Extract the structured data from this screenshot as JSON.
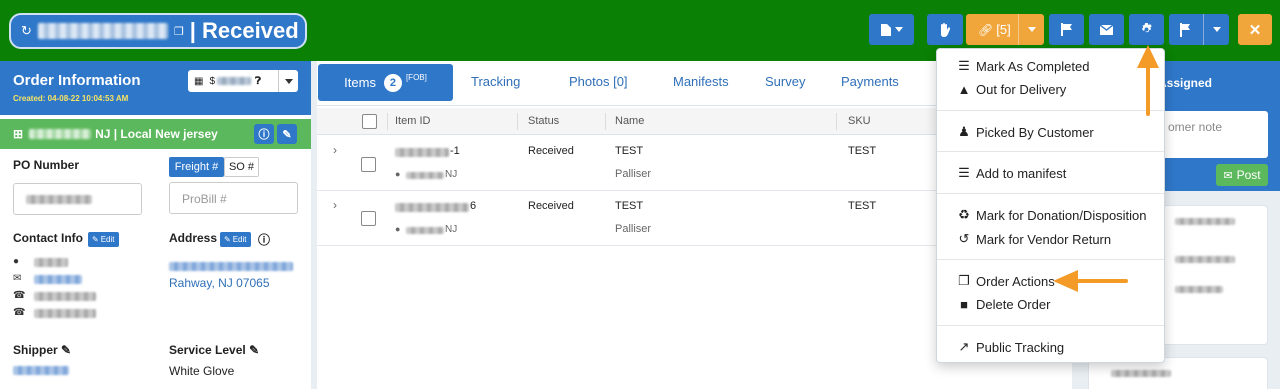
{
  "header": {
    "title": "| Received",
    "link_count": "[5]"
  },
  "order": {
    "heading": "Order Information",
    "created": "Created: 04-08-22 10:04:53 AM",
    "money_prefix": "$",
    "location": "NJ | Local New jersey",
    "po_label": "PO Number",
    "freight_tab": "Freight #",
    "so_tab": "SO #",
    "probill_placeholder": "ProBill #",
    "contact_label": "Contact Info",
    "edit_label": "Edit",
    "address_label": "Address",
    "address_line2": "Rahway, NJ 07065",
    "shipper_label": "Shipper",
    "service_label": "Service Level",
    "service_value": "White Glove"
  },
  "tabs": {
    "items": "Items",
    "items_count": "2",
    "items_sup": "[FOB]",
    "tracking": "Tracking",
    "photos": "Photos [0]",
    "manifests": "Manifests",
    "survey": "Survey",
    "payments": "Payments"
  },
  "table": {
    "headers": [
      "Item ID",
      "Status",
      "Name",
      "SKU"
    ],
    "rows": [
      {
        "id_suffix": "-1",
        "status": "Received",
        "name": "TEST",
        "brand": "Palliser",
        "sku": "TEST",
        "loc_suffix": "NJ"
      },
      {
        "id_suffix": "6",
        "status": "Received",
        "name": "TEST",
        "brand": "Palliser",
        "sku": "TEST",
        "loc_suffix": "NJ"
      }
    ]
  },
  "right": {
    "assigned": "Assigned",
    "note_placeholder": "omer note",
    "post": "Post"
  },
  "menu": {
    "items": [
      {
        "label": "Mark As Completed",
        "icon": "list-check-icon"
      },
      {
        "label": "Out for Delivery",
        "icon": "truck-icon"
      },
      {
        "label": "Picked By Customer",
        "icon": "people-icon"
      },
      {
        "label": "Add to manifest",
        "icon": "list-icon"
      },
      {
        "label": "Mark for Donation/Disposition",
        "icon": "recycle-icon"
      },
      {
        "label": "Mark for Vendor Return",
        "icon": "undo-icon"
      },
      {
        "label": "Order Actions",
        "icon": "copy-icon"
      },
      {
        "label": "Delete Order",
        "icon": "trash-icon"
      },
      {
        "label": "Public Tracking",
        "icon": "external-link-icon"
      }
    ]
  },
  "colors": {
    "topbar": "#0a8004",
    "primary": "#2f77c9",
    "warning": "#f0a63b",
    "success": "#5cb85c",
    "arrow": "#f39a27"
  }
}
